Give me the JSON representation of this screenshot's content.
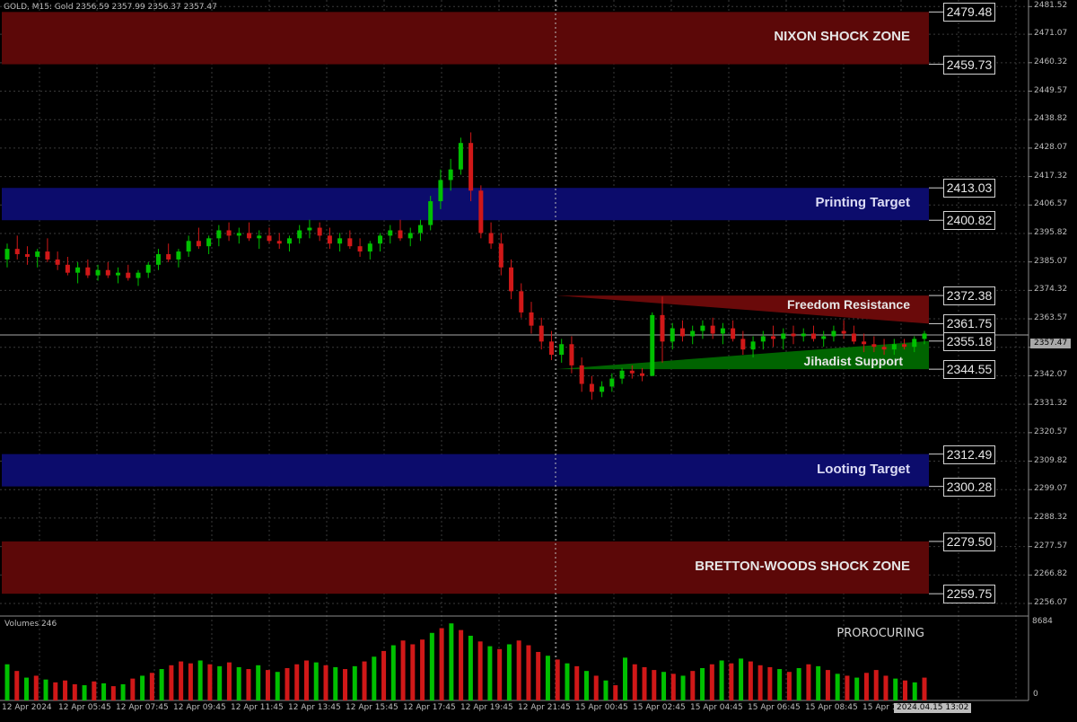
{
  "header": {
    "title": "GOLD, M15:  Gold  2356.59 2357.99 2356.37 2357.47"
  },
  "volumes_label": "Volumes 246",
  "volume_axis": {
    "max_label": "8684",
    "zero_label": "0"
  },
  "watermark": "PROROCURING",
  "current_price": "2357.47",
  "current_time": "2024.04.15 13:02",
  "colors": {
    "bull": "#00c000",
    "bear": "#d01818",
    "zone_red": "#5c0808",
    "zone_blue": "#0c0c6c",
    "grid": "#3a3a3a"
  },
  "zones": [
    {
      "name": "NIXON SHOCK ZONE",
      "top_label": "2479.48",
      "bottom_label": "2459.73",
      "top": 2479.48,
      "bottom": 2459.73,
      "kind": "red"
    },
    {
      "name": "Printing Target",
      "top_label": "2413.03",
      "bottom_label": "2400.82",
      "top": 2413.03,
      "bottom": 2400.82,
      "kind": "blue"
    },
    {
      "name": "Looting Target",
      "top_label": "2312.49",
      "bottom_label": "2300.28",
      "top": 2312.49,
      "bottom": 2300.28,
      "kind": "blue"
    },
    {
      "name": "BRETTON-WOODS SHOCK ZONE",
      "top_label": "2279.50",
      "bottom_label": "2259.75",
      "top": 2279.5,
      "bottom": 2259.75,
      "kind": "red"
    }
  ],
  "triangle": {
    "resistance_label": "Freedom Resistance",
    "support_label": "Jihadist Support",
    "resistance_top": "2372.38",
    "resistance_bottom": "2361.75",
    "support_top": "2355.18",
    "support_bottom": "2344.55"
  },
  "price_axis_ticks": [
    "2481.52",
    "2471.07",
    "2460.32",
    "2449.57",
    "2438.82",
    "2428.07",
    "2417.32",
    "2406.57",
    "2395.82",
    "2385.07",
    "2374.32",
    "2363.57",
    "2352.82",
    "2342.07",
    "2331.32",
    "2320.57",
    "2309.82",
    "2299.07",
    "2288.32",
    "2277.57",
    "2266.82",
    "2256.07"
  ],
  "time_axis_ticks": [
    "12 Apr 2024",
    "12 Apr 05:45",
    "12 Apr 07:45",
    "12 Apr 09:45",
    "12 Apr 11:45",
    "12 Apr 13:45",
    "12 Apr 15:45",
    "12 Apr 17:45",
    "12 Apr 19:45",
    "12 Apr 21:45",
    "15 Apr 00:45",
    "15 Apr 02:45",
    "15 Apr 04:45",
    "15 Apr 06:45",
    "15 Apr 08:45",
    "15 Apr 10:45"
  ],
  "chart_data": {
    "type": "candlestick",
    "symbol": "GOLD",
    "timeframe": "M15",
    "ylim": [
      2252,
      2484
    ],
    "candles": [
      [
        2386,
        2392,
        2383,
        2390
      ],
      [
        2390,
        2395,
        2386,
        2388
      ],
      [
        2388,
        2391,
        2384,
        2387
      ],
      [
        2387,
        2390,
        2383,
        2389
      ],
      [
        2389,
        2394,
        2385,
        2386
      ],
      [
        2386,
        2389,
        2382,
        2384
      ],
      [
        2384,
        2387,
        2380,
        2381
      ],
      [
        2381,
        2385,
        2377,
        2383
      ],
      [
        2383,
        2386,
        2379,
        2380
      ],
      [
        2380,
        2384,
        2378,
        2382
      ],
      [
        2382,
        2385,
        2379,
        2380
      ],
      [
        2380,
        2383,
        2377,
        2381
      ],
      [
        2381,
        2384,
        2378,
        2379
      ],
      [
        2379,
        2382,
        2376,
        2381
      ],
      [
        2381,
        2385,
        2379,
        2384
      ],
      [
        2384,
        2390,
        2382,
        2388
      ],
      [
        2388,
        2392,
        2385,
        2386
      ],
      [
        2386,
        2390,
        2383,
        2389
      ],
      [
        2389,
        2395,
        2387,
        2393
      ],
      [
        2393,
        2398,
        2390,
        2391
      ],
      [
        2391,
        2395,
        2388,
        2394
      ],
      [
        2394,
        2399,
        2391,
        2397
      ],
      [
        2397,
        2400,
        2393,
        2395
      ],
      [
        2395,
        2398,
        2392,
        2396
      ],
      [
        2396,
        2400,
        2393,
        2394
      ],
      [
        2394,
        2397,
        2390,
        2395
      ],
      [
        2395,
        2398,
        2392,
        2393
      ],
      [
        2393,
        2396,
        2390,
        2392
      ],
      [
        2392,
        2395,
        2389,
        2394
      ],
      [
        2394,
        2399,
        2392,
        2397
      ],
      [
        2397,
        2401,
        2394,
        2398
      ],
      [
        2398,
        2400,
        2393,
        2395
      ],
      [
        2395,
        2398,
        2390,
        2392
      ],
      [
        2392,
        2396,
        2389,
        2394
      ],
      [
        2394,
        2397,
        2390,
        2391
      ],
      [
        2391,
        2394,
        2387,
        2389
      ],
      [
        2389,
        2393,
        2386,
        2392
      ],
      [
        2392,
        2396,
        2389,
        2395
      ],
      [
        2395,
        2399,
        2392,
        2397
      ],
      [
        2397,
        2401,
        2393,
        2394
      ],
      [
        2394,
        2398,
        2391,
        2396
      ],
      [
        2396,
        2401,
        2393,
        2399
      ],
      [
        2399,
        2410,
        2397,
        2408
      ],
      [
        2408,
        2420,
        2405,
        2416
      ],
      [
        2416,
        2424,
        2412,
        2420
      ],
      [
        2420,
        2432,
        2418,
        2430
      ],
      [
        2430,
        2434,
        2408,
        2412
      ],
      [
        2412,
        2414,
        2394,
        2396
      ],
      [
        2396,
        2400,
        2390,
        2392
      ],
      [
        2392,
        2396,
        2380,
        2383
      ],
      [
        2383,
        2386,
        2371,
        2374
      ],
      [
        2374,
        2377,
        2364,
        2366
      ],
      [
        2366,
        2370,
        2358,
        2361
      ],
      [
        2361,
        2364,
        2352,
        2355
      ],
      [
        2355,
        2359,
        2348,
        2350
      ],
      [
        2350,
        2356,
        2347,
        2354
      ],
      [
        2354,
        2357,
        2343,
        2346
      ],
      [
        2346,
        2349,
        2336,
        2339
      ],
      [
        2339,
        2342,
        2333,
        2336
      ],
      [
        2336,
        2340,
        2334,
        2338
      ],
      [
        2338,
        2343,
        2336,
        2341
      ],
      [
        2341,
        2345,
        2339,
        2344
      ],
      [
        2344,
        2346,
        2341,
        2343
      ],
      [
        2343,
        2345,
        2340,
        2342
      ],
      [
        2342,
        2366,
        2345,
        2365
      ],
      [
        2365,
        2372,
        2347,
        2355
      ],
      [
        2355,
        2362,
        2352,
        2360
      ],
      [
        2360,
        2363,
        2355,
        2357
      ],
      [
        2357,
        2361,
        2354,
        2359
      ],
      [
        2359,
        2363,
        2356,
        2361
      ],
      [
        2361,
        2364,
        2356,
        2358
      ],
      [
        2358,
        2362,
        2354,
        2360
      ],
      [
        2360,
        2363,
        2355,
        2356
      ],
      [
        2356,
        2359,
        2350,
        2352
      ],
      [
        2352,
        2357,
        2349,
        2355
      ],
      [
        2355,
        2359,
        2352,
        2357
      ],
      [
        2357,
        2361,
        2353,
        2356
      ],
      [
        2356,
        2360,
        2352,
        2358
      ],
      [
        2358,
        2361,
        2354,
        2357
      ],
      [
        2357,
        2360,
        2355,
        2358
      ],
      [
        2358,
        2361,
        2355,
        2356
      ],
      [
        2356,
        2359,
        2353,
        2357
      ],
      [
        2357,
        2361,
        2355,
        2359
      ],
      [
        2359,
        2363,
        2356,
        2358
      ],
      [
        2358,
        2361,
        2354,
        2355
      ],
      [
        2355,
        2358,
        2351,
        2354
      ],
      [
        2354,
        2357,
        2351,
        2353
      ],
      [
        2353,
        2356,
        2350,
        2352
      ],
      [
        2352,
        2356,
        2350,
        2354
      ],
      [
        2354,
        2356,
        2352,
        2353
      ],
      [
        2353,
        2357,
        2351,
        2356
      ],
      [
        2356,
        2359,
        2354,
        2358
      ]
    ],
    "volumes": [
      3800,
      3100,
      2400,
      2600,
      2200,
      1900,
      2100,
      1700,
      1600,
      2000,
      1800,
      1500,
      1700,
      2300,
      2600,
      2900,
      3300,
      3700,
      4100,
      3900,
      4200,
      3800,
      3600,
      4000,
      3500,
      3300,
      3700,
      3200,
      3000,
      3400,
      3800,
      4200,
      4000,
      3700,
      3500,
      3300,
      3600,
      4100,
      4600,
      5200,
      5800,
      6300,
      5900,
      6400,
      7100,
      7600,
      8100,
      7400,
      6800,
      6200,
      5700,
      5400,
      5900,
      6300,
      5800,
      5100,
      4700,
      4300,
      3900,
      3600,
      3100,
      2600,
      2100,
      1600,
      4500,
      3800,
      3500,
      3200,
      3000,
      2800,
      2600,
      3100,
      3400,
      3800,
      4200,
      3900,
      4400,
      4100,
      3700,
      3500,
      3300,
      3000,
      3400,
      3800,
      3600,
      3200,
      2800,
      2600,
      2400,
      2900,
      3200,
      2600,
      2300,
      2100,
      1900,
      2400
    ]
  }
}
